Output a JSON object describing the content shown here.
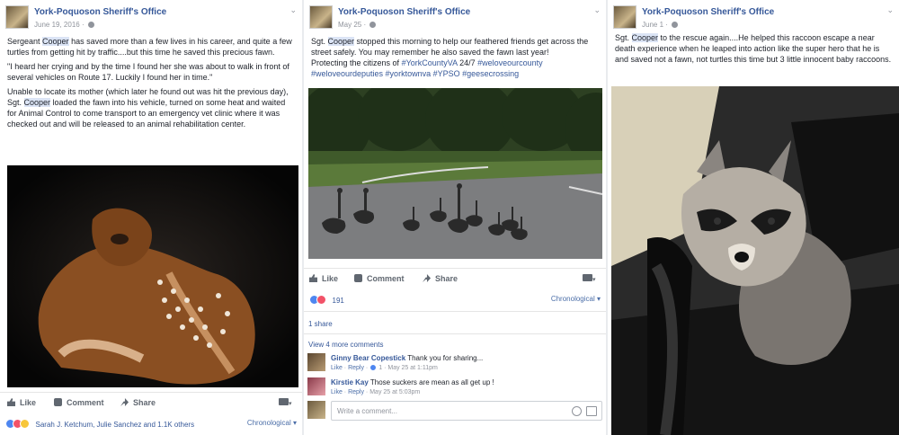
{
  "posts": [
    {
      "page_name": "York-Poquoson Sheriff's Office",
      "date": "June 19, 2016",
      "text": {
        "p1_a": "Sergeant ",
        "p1_hl": "Cooper",
        "p1_b": " has saved more than a few lives in his career, and quite a few turtles from getting hit by traffic....but this time he saved this precious fawn.",
        "p2": "\"I heard her crying and by the time I found her she was about to walk in front of several vehicles on Route 17. Luckily I found her in time.\"",
        "p3_a": "Unable to locate its mother (which later he found out was hit the previous day), Sgt. ",
        "p3_hl": "Cooper",
        "p3_b": " loaded the fawn into his vehicle, turned on some heat and waited for Animal Control to come transport to an emergency vet clinic where it was checked out and will be released to an animal rehabilitation center."
      },
      "actions": {
        "like": "Like",
        "comment": "Comment",
        "share": "Share"
      },
      "reactions_text": "Sarah J. Ketchum, Julie Sanchez and 1.1K others",
      "order": "Chronological"
    },
    {
      "page_name": "York-Poquoson Sheriff's Office",
      "date": "May 25",
      "text": {
        "a": "Sgt. ",
        "hl": "Cooper",
        "b": " stopped this morning to help our feathered friends get across the street safely. You may remember he also saved the fawn last year!",
        "c": "Protecting the citizens of ",
        "tags_line1": "#YorkCountyVA",
        "d": " 24/7 ",
        "tags_line1b": "#weloveourcounty",
        "tags_line2": "#weloveourdeputies #yorktownva #YPSO #geesecrossing"
      },
      "actions": {
        "like": "Like",
        "comment": "Comment",
        "share": "Share"
      },
      "reaction_count": "191",
      "order": "Chronological",
      "shares": "1 share",
      "view_more": "View 4 more comments",
      "comments": [
        {
          "name": "Ginny Bear Copestick",
          "text": "Thank you for sharing...",
          "like": "Like",
          "reply": "Reply",
          "likes": "1",
          "time": "May 25 at 1:11pm"
        },
        {
          "name": "Kirstie Kay",
          "text": "Those suckers are mean as all get up !",
          "like": "Like",
          "reply": "Reply",
          "time": "May 25 at 5:03pm"
        }
      ],
      "write_placeholder": "Write a comment..."
    },
    {
      "page_name": "York-Poquoson Sheriff's Office",
      "date": "June 1",
      "text": {
        "a": "Sgt. ",
        "hl": "Cooper",
        "b": " to the rescue again....He helped this raccoon escape a near death experience when he leaped into action like the super hero that he is and saved not a fawn, not turtles this time but 3 little innocent baby raccoons."
      }
    }
  ],
  "colors": {
    "link": "#365899",
    "highlight": "#dbe4f5",
    "background": "#e9ebee"
  }
}
